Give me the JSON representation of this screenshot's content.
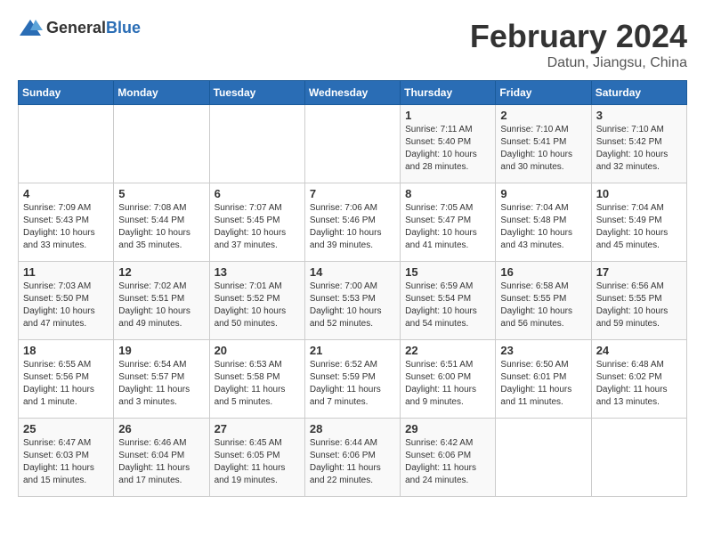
{
  "header": {
    "logo_general": "General",
    "logo_blue": "Blue",
    "title": "February 2024",
    "location": "Datun, Jiangsu, China"
  },
  "weekdays": [
    "Sunday",
    "Monday",
    "Tuesday",
    "Wednesday",
    "Thursday",
    "Friday",
    "Saturday"
  ],
  "weeks": [
    [
      {
        "day": "",
        "info": ""
      },
      {
        "day": "",
        "info": ""
      },
      {
        "day": "",
        "info": ""
      },
      {
        "day": "",
        "info": ""
      },
      {
        "day": "1",
        "info": "Sunrise: 7:11 AM\nSunset: 5:40 PM\nDaylight: 10 hours\nand 28 minutes."
      },
      {
        "day": "2",
        "info": "Sunrise: 7:10 AM\nSunset: 5:41 PM\nDaylight: 10 hours\nand 30 minutes."
      },
      {
        "day": "3",
        "info": "Sunrise: 7:10 AM\nSunset: 5:42 PM\nDaylight: 10 hours\nand 32 minutes."
      }
    ],
    [
      {
        "day": "4",
        "info": "Sunrise: 7:09 AM\nSunset: 5:43 PM\nDaylight: 10 hours\nand 33 minutes."
      },
      {
        "day": "5",
        "info": "Sunrise: 7:08 AM\nSunset: 5:44 PM\nDaylight: 10 hours\nand 35 minutes."
      },
      {
        "day": "6",
        "info": "Sunrise: 7:07 AM\nSunset: 5:45 PM\nDaylight: 10 hours\nand 37 minutes."
      },
      {
        "day": "7",
        "info": "Sunrise: 7:06 AM\nSunset: 5:46 PM\nDaylight: 10 hours\nand 39 minutes."
      },
      {
        "day": "8",
        "info": "Sunrise: 7:05 AM\nSunset: 5:47 PM\nDaylight: 10 hours\nand 41 minutes."
      },
      {
        "day": "9",
        "info": "Sunrise: 7:04 AM\nSunset: 5:48 PM\nDaylight: 10 hours\nand 43 minutes."
      },
      {
        "day": "10",
        "info": "Sunrise: 7:04 AM\nSunset: 5:49 PM\nDaylight: 10 hours\nand 45 minutes."
      }
    ],
    [
      {
        "day": "11",
        "info": "Sunrise: 7:03 AM\nSunset: 5:50 PM\nDaylight: 10 hours\nand 47 minutes."
      },
      {
        "day": "12",
        "info": "Sunrise: 7:02 AM\nSunset: 5:51 PM\nDaylight: 10 hours\nand 49 minutes."
      },
      {
        "day": "13",
        "info": "Sunrise: 7:01 AM\nSunset: 5:52 PM\nDaylight: 10 hours\nand 50 minutes."
      },
      {
        "day": "14",
        "info": "Sunrise: 7:00 AM\nSunset: 5:53 PM\nDaylight: 10 hours\nand 52 minutes."
      },
      {
        "day": "15",
        "info": "Sunrise: 6:59 AM\nSunset: 5:54 PM\nDaylight: 10 hours\nand 54 minutes."
      },
      {
        "day": "16",
        "info": "Sunrise: 6:58 AM\nSunset: 5:55 PM\nDaylight: 10 hours\nand 56 minutes."
      },
      {
        "day": "17",
        "info": "Sunrise: 6:56 AM\nSunset: 5:55 PM\nDaylight: 10 hours\nand 59 minutes."
      }
    ],
    [
      {
        "day": "18",
        "info": "Sunrise: 6:55 AM\nSunset: 5:56 PM\nDaylight: 11 hours\nand 1 minute."
      },
      {
        "day": "19",
        "info": "Sunrise: 6:54 AM\nSunset: 5:57 PM\nDaylight: 11 hours\nand 3 minutes."
      },
      {
        "day": "20",
        "info": "Sunrise: 6:53 AM\nSunset: 5:58 PM\nDaylight: 11 hours\nand 5 minutes."
      },
      {
        "day": "21",
        "info": "Sunrise: 6:52 AM\nSunset: 5:59 PM\nDaylight: 11 hours\nand 7 minutes."
      },
      {
        "day": "22",
        "info": "Sunrise: 6:51 AM\nSunset: 6:00 PM\nDaylight: 11 hours\nand 9 minutes."
      },
      {
        "day": "23",
        "info": "Sunrise: 6:50 AM\nSunset: 6:01 PM\nDaylight: 11 hours\nand 11 minutes."
      },
      {
        "day": "24",
        "info": "Sunrise: 6:48 AM\nSunset: 6:02 PM\nDaylight: 11 hours\nand 13 minutes."
      }
    ],
    [
      {
        "day": "25",
        "info": "Sunrise: 6:47 AM\nSunset: 6:03 PM\nDaylight: 11 hours\nand 15 minutes."
      },
      {
        "day": "26",
        "info": "Sunrise: 6:46 AM\nSunset: 6:04 PM\nDaylight: 11 hours\nand 17 minutes."
      },
      {
        "day": "27",
        "info": "Sunrise: 6:45 AM\nSunset: 6:05 PM\nDaylight: 11 hours\nand 19 minutes."
      },
      {
        "day": "28",
        "info": "Sunrise: 6:44 AM\nSunset: 6:06 PM\nDaylight: 11 hours\nand 22 minutes."
      },
      {
        "day": "29",
        "info": "Sunrise: 6:42 AM\nSunset: 6:06 PM\nDaylight: 11 hours\nand 24 minutes."
      },
      {
        "day": "",
        "info": ""
      },
      {
        "day": "",
        "info": ""
      }
    ]
  ]
}
